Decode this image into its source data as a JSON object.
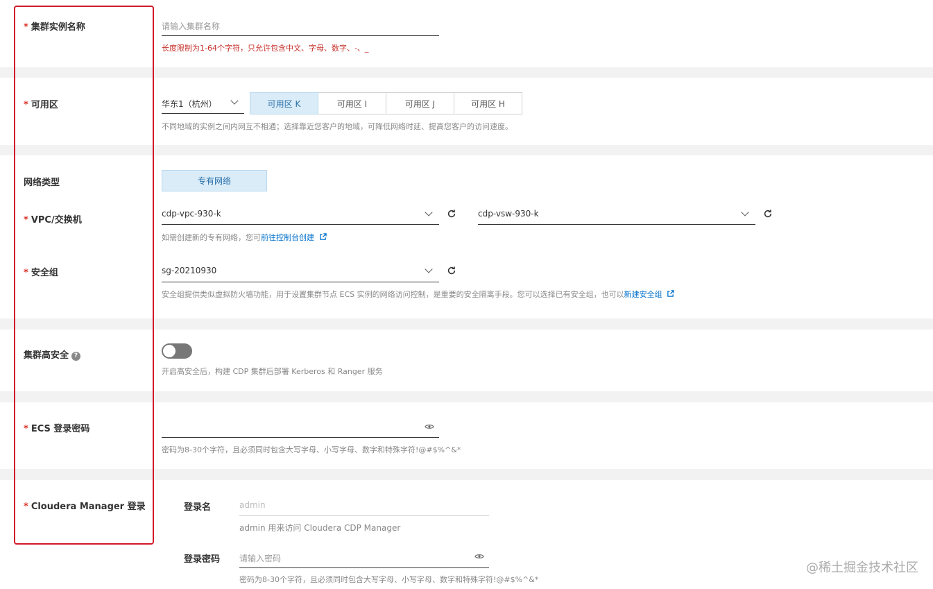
{
  "cluster_name": {
    "label": "集群实例名称",
    "placeholder": "请输入集群名称",
    "error": "长度限制为1-64个字符，只允许包含中文、字母、数字、-、_"
  },
  "zone": {
    "label": "可用区",
    "region": "华东1（杭州）",
    "options": [
      "可用区 K",
      "可用区 I",
      "可用区 J",
      "可用区 H"
    ],
    "selected": "可用区 K",
    "help": "不同地域的实例之间内网互不相通；选择靠近您客户的地域，可降低网络时延、提高您客户的访问速度。"
  },
  "network": {
    "label": "网络类型",
    "type": "专有网络"
  },
  "vpc": {
    "label": "VPC/交换机",
    "vpc_value": "cdp-vpc-930-k",
    "vsw_value": "cdp-vsw-930-k",
    "help_prefix": "如需创建新的专有网络，您可",
    "help_link": "前往控制台创建"
  },
  "security_group": {
    "label": "安全组",
    "value": "sg-20210930",
    "help_prefix": "安全组提供类似虚拟防火墙功能，用于设置集群节点 ECS 实例的网络访问控制，是重要的安全隔离手段。您可以选择已有安全组，也可以",
    "help_link": "新建安全组"
  },
  "high_security": {
    "label": "集群高安全",
    "enabled": false,
    "help": "开启高安全后，构建 CDP 集群后部署 Kerberos 和 Ranger 服务"
  },
  "ecs_password": {
    "label": "ECS 登录密码",
    "help": "密码为8-30个字符，且必须同时包含大写字母、小写字母、数字和特殊字符!@#$%^&*"
  },
  "cm_login": {
    "label": "Cloudera Manager 登录",
    "username_label": "登录名",
    "username_placeholder": "admin",
    "username_help": "admin 用来访问 Cloudera CDP Manager",
    "password_label": "登录密码",
    "password_placeholder": "请输入密码",
    "password_help": "密码为8-30个字符，且必须同时包含大写字母、小写字母、数字和特殊字符!@#$%^&*"
  },
  "required_mark": "*",
  "watermark": "@稀土掘金技术社区",
  "colors": {
    "accent": "#0070cc",
    "selected_bg": "#d9ecf8",
    "error": "#c7302b",
    "highlight_box": "#d11a2a"
  }
}
